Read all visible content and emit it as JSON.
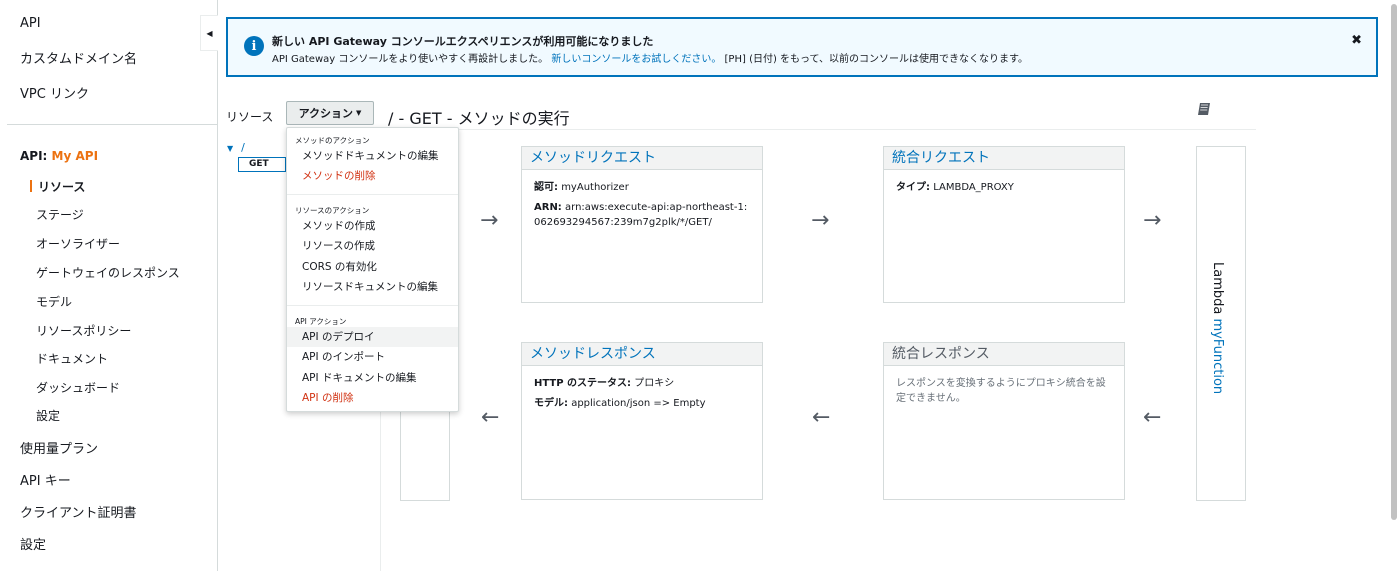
{
  "sidebar": {
    "top_items": [
      "API",
      "カスタムドメイン名",
      "VPC リンク"
    ],
    "api_prefix": "API:",
    "api_name": "My API",
    "sub_items": [
      "リソース",
      "ステージ",
      "オーソライザー",
      "ゲートウェイのレスポンス",
      "モデル",
      "リソースポリシー",
      "ドキュメント",
      "ダッシュボード",
      "設定"
    ],
    "active_item": "リソース",
    "bottom_items": [
      "使用量プラン",
      "API キー",
      "クライアント証明書",
      "設定"
    ]
  },
  "banner": {
    "title": "新しい API Gateway コンソールエクスペリエンスが利用可能になりました",
    "text_before": "API Gateway コンソールをより使いやすく再設計しました。",
    "link": "新しいコンソールをお試しください。",
    "text_after": "[PH] (日付) をもって、以前のコンソールは使用できなくなります。",
    "close_label": "✖",
    "info_icon": "i"
  },
  "resources_label": "リソース",
  "actions_button": "アクション",
  "page_title": "/ - GET - メソッドの実行",
  "tree": {
    "root": "/",
    "method": "GET"
  },
  "dropdown": {
    "groups": [
      {
        "label": "メソッドのアクション",
        "items": [
          {
            "label": "メソッドドキュメントの編集",
            "danger": false
          },
          {
            "label": "メソッドの削除",
            "danger": true
          }
        ]
      },
      {
        "label": "リソースのアクション",
        "items": [
          {
            "label": "メソッドの作成",
            "danger": false
          },
          {
            "label": "リソースの作成",
            "danger": false
          },
          {
            "label": "CORS の有効化",
            "danger": false
          },
          {
            "label": "リソースドキュメントの編集",
            "danger": false
          }
        ]
      },
      {
        "label": "API アクション",
        "items": [
          {
            "label": "API のデプロイ",
            "danger": false
          },
          {
            "label": "API のインポート",
            "danger": false
          },
          {
            "label": "API ドキュメントの編集",
            "danger": false
          },
          {
            "label": "API の削除",
            "danger": true
          }
        ]
      }
    ],
    "hovered": "API のデプロイ"
  },
  "method_request": {
    "title": "メソッドリクエスト",
    "auth_label": "認可:",
    "auth_value": "myAuthorizer",
    "arn_label": "ARN:",
    "arn_value": "arn:aws:execute-api:ap-northeast-1:062693294567:239m7g2plk/*/GET/"
  },
  "integration_request": {
    "title": "統合リクエスト",
    "type_label": "タイプ:",
    "type_value": "LAMBDA_PROXY"
  },
  "method_response": {
    "title": "メソッドレスポンス",
    "status_label": "HTTP のステータス:",
    "status_value": "プロキシ",
    "model_label": "モデル:",
    "model_value": "application/json => Empty"
  },
  "integration_response": {
    "title": "統合レスポンス",
    "note": "レスポンスを変換するようにプロキシ統合を設定できません。"
  },
  "lambda": {
    "prefix": "Lambda",
    "function": "myFunction"
  },
  "arrows": {
    "right": "→",
    "left": "←"
  },
  "icons": {
    "book": "book-icon",
    "collapse": "◀"
  },
  "colors": {
    "accent": "#ec7211",
    "link": "#0073bb",
    "danger": "#d13212",
    "banner_bg": "#f1faff"
  }
}
